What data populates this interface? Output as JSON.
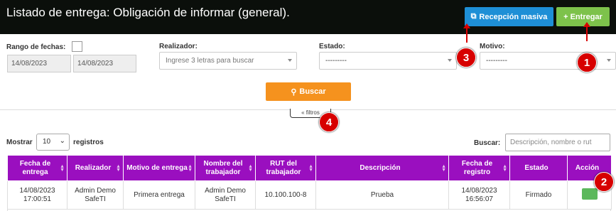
{
  "header": {
    "title": "Listado de entrega: Obligación de informar (general).",
    "btn_masiva": "Recepción masiva",
    "btn_entregar": "Entregar",
    "icon_masiva": "copy-icon",
    "icon_entregar": "plus-icon"
  },
  "filters": {
    "rango_label": "Rango de fechas:",
    "date_from": "14/08/2023",
    "date_to": "14/08/2023",
    "realizador_label": "Realizador:",
    "realizador_placeholder": "Ingrese 3 letras para buscar",
    "estado_label": "Estado:",
    "estado_value": "---------",
    "motivo_label": "Motivo:",
    "motivo_value": "---------",
    "buscar_button": "Buscar",
    "filtros_toggle": "« filtros"
  },
  "table_controls": {
    "mostrar": "Mostrar",
    "length_value": "10",
    "registros": "registros",
    "buscar_label": "Buscar:",
    "search_placeholder": "Descripción, nombre o rut"
  },
  "table": {
    "headers": [
      "Fecha de entrega",
      "Realizador",
      "Motivo de entrega",
      "Nombre del trabajador",
      "RUT del trabajador",
      "Descripción",
      "Fecha de registro",
      "Estado",
      "Acción"
    ],
    "rows": [
      {
        "fecha_entrega": "14/08/2023 17:00:51",
        "realizador": "Admin Demo SafeTI",
        "motivo": "Primera entrega",
        "nombre": "Admin Demo SafeTI",
        "rut": "10.100.100-8",
        "descripcion": "Prueba",
        "fecha_registro": "14/08/2023 16:56:07",
        "estado": "Firmado"
      }
    ]
  },
  "annotations": [
    "1",
    "2",
    "3",
    "4"
  ],
  "colors": {
    "topbar": "#0b0f0b",
    "masiva": "#1e8fd6",
    "entregar": "#7dc24b",
    "buscar": "#f5921e",
    "table_header": "#9a0fbf",
    "annotation": "#d70000"
  }
}
